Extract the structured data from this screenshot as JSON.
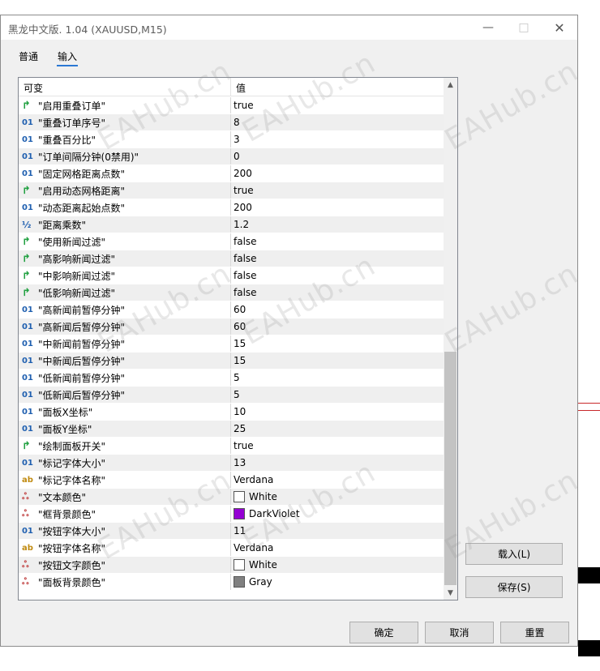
{
  "window": {
    "title": "黑龙中文版. 1.04 (XAUUSD,M15)",
    "minimize_icon": "minimize-icon",
    "maximize_icon": "maximize-icon",
    "close_icon": "close-icon"
  },
  "tabs": [
    {
      "label": "普通",
      "active": false
    },
    {
      "label": "输入",
      "active": true
    }
  ],
  "grid": {
    "col_name": "可变",
    "col_value": "值",
    "rows": [
      {
        "type": "bool",
        "name": "\"启用重叠订单\"",
        "value": "true"
      },
      {
        "type": "int",
        "name": "\"重叠订单序号\"",
        "value": "8"
      },
      {
        "type": "int",
        "name": "\"重叠百分比\"",
        "value": "3"
      },
      {
        "type": "int",
        "name": "\"订单间隔分钟(0禁用)\"",
        "value": "0"
      },
      {
        "type": "int",
        "name": "\"固定网格距离点数\"",
        "value": "200"
      },
      {
        "type": "bool",
        "name": "\"启用动态网格距离\"",
        "value": "true"
      },
      {
        "type": "int",
        "name": "\"动态距离起始点数\"",
        "value": "200"
      },
      {
        "type": "double",
        "name": "\"距离乘数\"",
        "value": "1.2"
      },
      {
        "type": "bool",
        "name": "\"使用新闻过滤\"",
        "value": "false"
      },
      {
        "type": "bool",
        "name": "\"高影响新闻过滤\"",
        "value": "false"
      },
      {
        "type": "bool",
        "name": "\"中影响新闻过滤\"",
        "value": "false"
      },
      {
        "type": "bool",
        "name": "\"低影响新闻过滤\"",
        "value": "false"
      },
      {
        "type": "int",
        "name": "\"高新闻前暂停分钟\"",
        "value": "60"
      },
      {
        "type": "int",
        "name": "\"高新闻后暂停分钟\"",
        "value": "60"
      },
      {
        "type": "int",
        "name": "\"中新闻前暂停分钟\"",
        "value": "15"
      },
      {
        "type": "int",
        "name": "\"中新闻后暂停分钟\"",
        "value": "15"
      },
      {
        "type": "int",
        "name": "\"低新闻前暂停分钟\"",
        "value": "5"
      },
      {
        "type": "int",
        "name": "\"低新闻后暂停分钟\"",
        "value": "5"
      },
      {
        "type": "int",
        "name": "\"面板X坐标\"",
        "value": "10"
      },
      {
        "type": "int",
        "name": "\"面板Y坐标\"",
        "value": "25"
      },
      {
        "type": "bool",
        "name": "\"绘制面板开关\"",
        "value": "true"
      },
      {
        "type": "int",
        "name": "\"标记字体大小\"",
        "value": "13"
      },
      {
        "type": "string",
        "name": "\"标记字体名称\"",
        "value": "Verdana"
      },
      {
        "type": "color",
        "name": "\"文本颜色\"",
        "value": "White",
        "color": "#ffffff"
      },
      {
        "type": "color",
        "name": "\"框背景颜色\"",
        "value": "DarkViolet",
        "color": "#9400d3"
      },
      {
        "type": "int",
        "name": "\"按钮字体大小\"",
        "value": "11"
      },
      {
        "type": "string",
        "name": "\"按钮字体名称\"",
        "value": "Verdana"
      },
      {
        "type": "color",
        "name": "\"按钮文字颜色\"",
        "value": "White",
        "color": "#ffffff"
      },
      {
        "type": "color",
        "name": "\"面板背景颜色\"",
        "value": "Gray",
        "color": "#808080"
      }
    ],
    "type_icons": {
      "int": "01",
      "bool": "↱",
      "double": "½",
      "string": "ab",
      "color": "ஃ"
    }
  },
  "side_buttons": {
    "load": "载入(L)",
    "save": "保存(S)"
  },
  "bottom_buttons": {
    "ok": "确定",
    "cancel": "取消",
    "reset": "重置"
  },
  "watermark": "EAHub.cn",
  "colors": {
    "tab_accent": "#2b78d4",
    "row_alt": "#efefef",
    "scroll_thumb": "#c3c3c3"
  }
}
